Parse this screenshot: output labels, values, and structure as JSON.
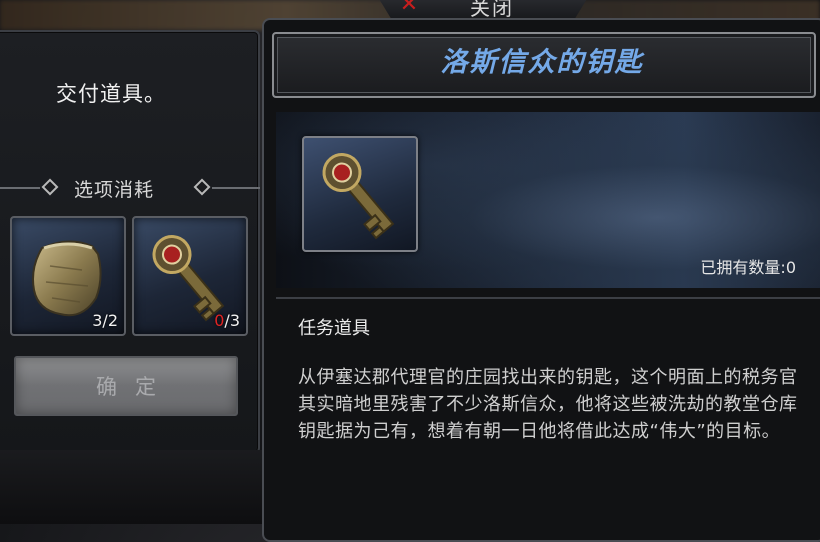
{
  "close_tab": {
    "label": "关闭",
    "icon": "close-x-icon",
    "icon_color": "#c81e1e"
  },
  "left_panel": {
    "instruction": "交付道具。",
    "consume_label": "选项消耗",
    "slots": [
      {
        "icon": "pouch-icon",
        "owned": "3",
        "required": "2"
      },
      {
        "icon": "key-icon",
        "owned": "0",
        "required": "3",
        "owned_color": "#e02424"
      }
    ],
    "confirm_label": "确定"
  },
  "item_detail": {
    "title": "洛斯信众的钥匙",
    "title_color": "#74a9e8",
    "icon": "key-icon",
    "owned_text": "已拥有数量:0",
    "type": "任务道具",
    "description": "从伊塞达郡代理官的庄园找出来的钥匙，这个明面上的税务官其实暗地里残害了不少洛斯信众，他将这些被洗劫的教堂仓库钥匙据为己有，想着有朝一日他将借此达成“伟大”的目标。"
  }
}
